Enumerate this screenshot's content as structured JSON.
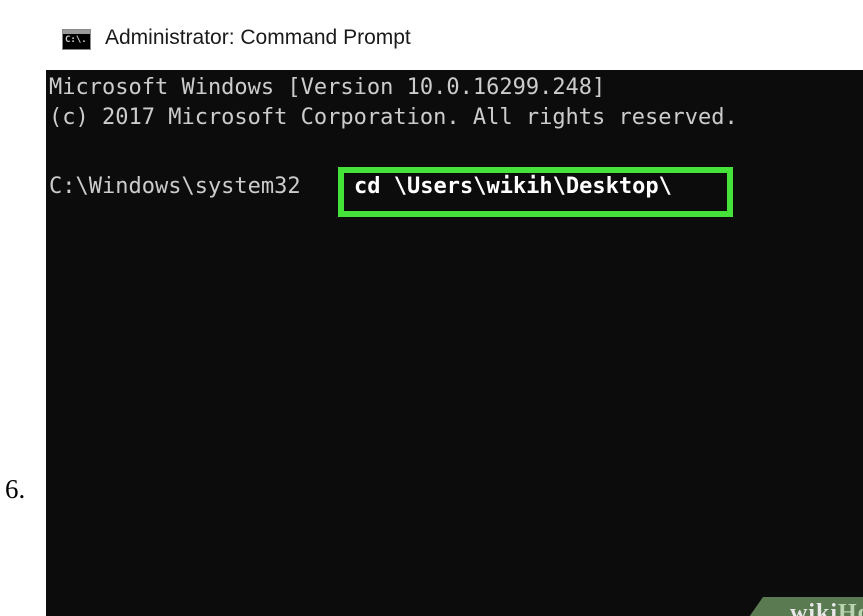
{
  "step": {
    "number": "6."
  },
  "window": {
    "title": "Administrator: Command Prompt",
    "icon": "command-prompt-icon",
    "icon_glyph": "C:\\."
  },
  "console": {
    "lines": [
      "Microsoft Windows [Version 10.0.16299.248]",
      "(c) 2017 Microsoft Corporation. All rights reserved."
    ],
    "prompt": "C:\\Windows\\system32",
    "command": "cd \\Users\\wikih\\Desktop\\"
  },
  "highlight_color": "#45e33a",
  "watermark": {
    "prefix": "wiki",
    "suffix": "How"
  }
}
